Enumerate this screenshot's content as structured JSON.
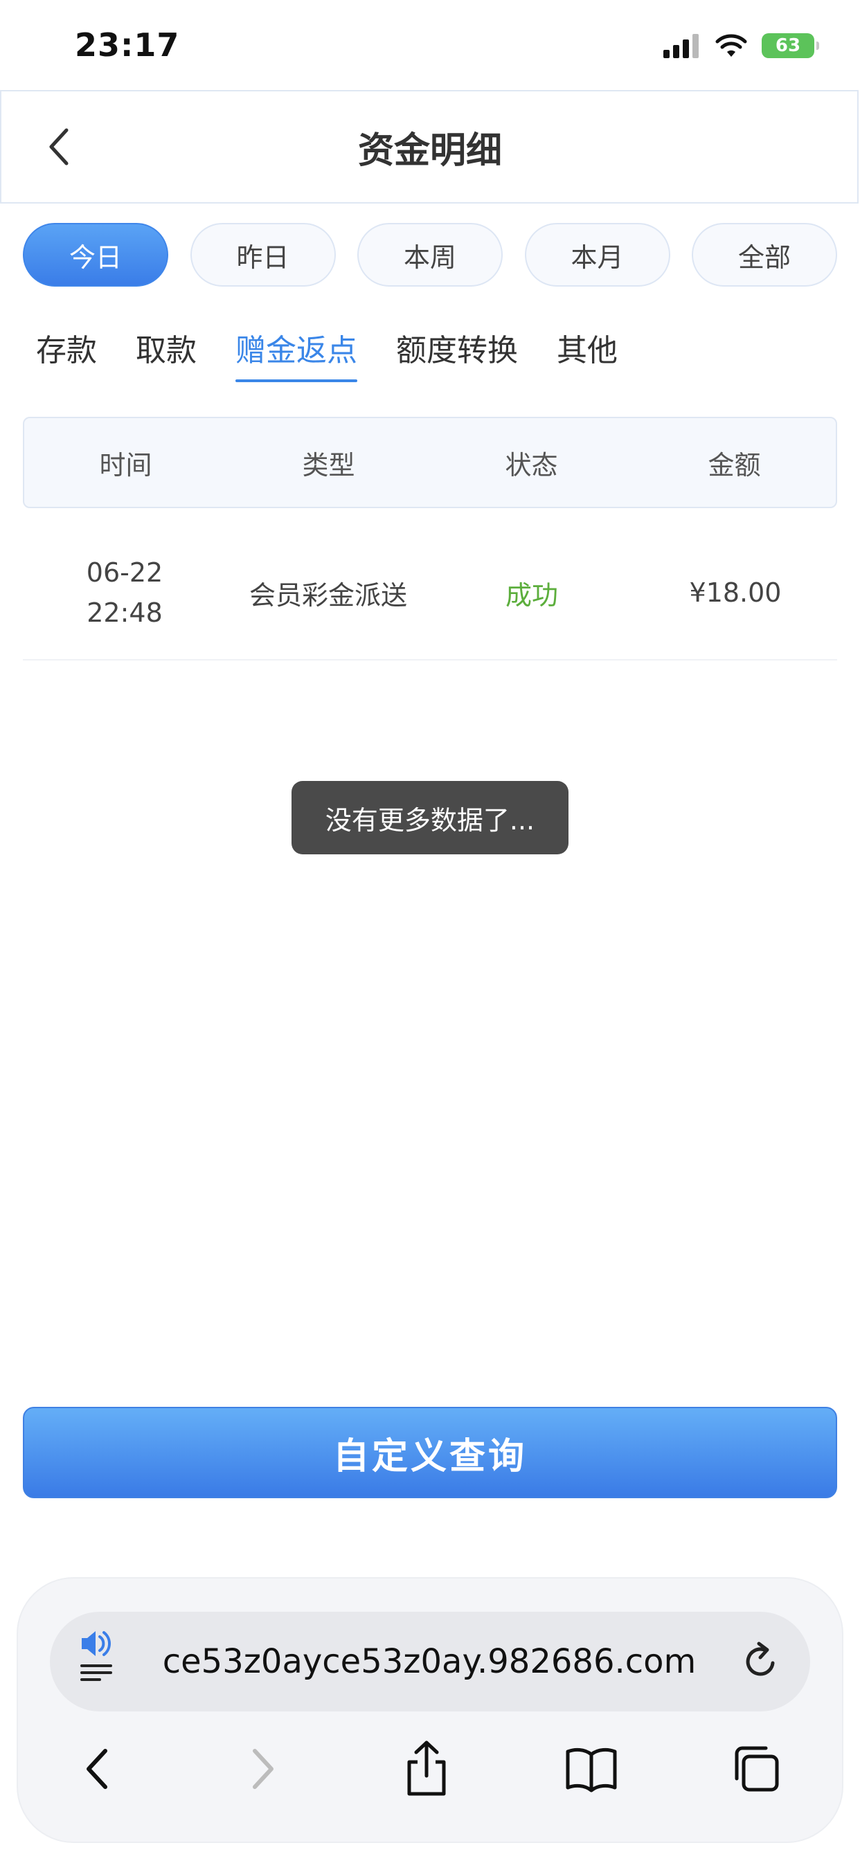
{
  "status_bar": {
    "time": "23:17",
    "battery": "63"
  },
  "header": {
    "title": "资金明细"
  },
  "date_filters": [
    {
      "label": "今日",
      "active": true
    },
    {
      "label": "昨日",
      "active": false
    },
    {
      "label": "本周",
      "active": false
    },
    {
      "label": "本月",
      "active": false
    },
    {
      "label": "全部",
      "active": false
    }
  ],
  "category_tabs": [
    {
      "label": "存款",
      "active": false
    },
    {
      "label": "取款",
      "active": false
    },
    {
      "label": "赠金返点",
      "active": true
    },
    {
      "label": "额度转换",
      "active": false
    },
    {
      "label": "其他",
      "active": false
    }
  ],
  "table": {
    "headers": [
      "时间",
      "类型",
      "状态",
      "金额"
    ],
    "rows": [
      {
        "date": "06-22",
        "time": "22:48",
        "type": "会员彩金派送",
        "status": "成功",
        "amount": "¥18.00"
      }
    ]
  },
  "toast": "没有更多数据了...",
  "actions": {
    "custom_query": "自定义查询"
  },
  "browser": {
    "url": "ce53z0ayce53z0ay.982686.com"
  },
  "colors": {
    "accent": "#3a86e8",
    "success": "#5cae3c",
    "toast_bg": "#4a4a4a"
  }
}
